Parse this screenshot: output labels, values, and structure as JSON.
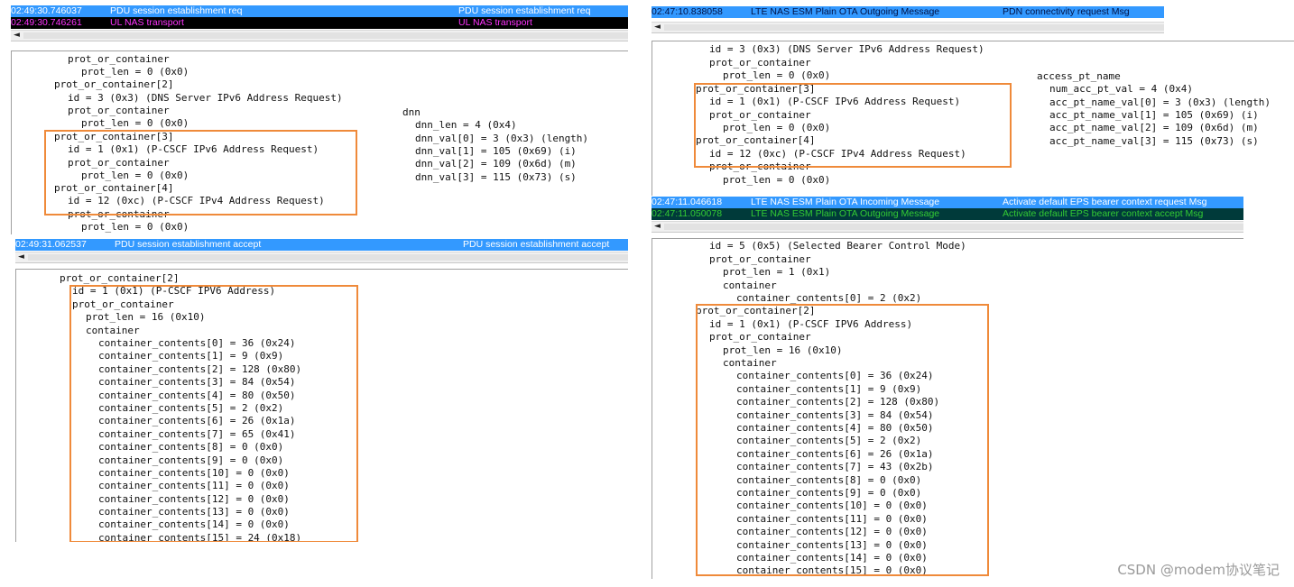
{
  "top_left": {
    "log_rows": [
      {
        "time": "02:49:30.746037",
        "type": "PDU  session  establishment  req",
        "summary": "PDU  session  establishment  req"
      },
      {
        "time": "02:49:30.746261",
        "type": "UL  NAS  transport",
        "summary": "UL  NAS  transport"
      }
    ],
    "scroll_arrow": "◄",
    "tree_lines": [
      "prot_or_container",
      "prot_len = 0 (0x0)",
      "prot_or_container[2]",
      "id = 3 (0x3) (DNS Server IPv6 Address Request)",
      "prot_or_container",
      "prot_len = 0 (0x0)",
      "prot_or_container[3]",
      "id = 1 (0x1) (P-CSCF IPv6 Address Request)",
      "prot_or_container",
      "prot_len = 0 (0x0)",
      "prot_or_container[4]",
      "id = 12 (0xc) (P-CSCF IPv4 Address Request)",
      "prot_or_container",
      "prot_len = 0 (0x0)"
    ],
    "dnn_lines": [
      "dnn",
      "dnn_len = 4 (0x4)",
      "dnn_val[0] = 3 (0x3) (length)",
      "dnn_val[1] = 105 (0x69) (i)",
      "dnn_val[2] = 109 (0x6d) (m)",
      "dnn_val[3] = 115 (0x73) (s)"
    ]
  },
  "bottom_left": {
    "log_rows": [
      {
        "time": "02:49:31.062537",
        "type": "PDU  session  establishment  accept",
        "summary": "PDU  session  establishment  accept"
      }
    ],
    "scroll_arrow": "◄",
    "tree_lines": [
      "prot_or_container[2]",
      "id = 1 (0x1) (P-CSCF IPV6 Address)",
      "prot_or_container",
      "prot_len = 16 (0x10)",
      "container",
      "container_contents[0] = 36 (0x24)",
      "container_contents[1] = 9 (0x9)",
      "container_contents[2] = 128 (0x80)",
      "container_contents[3] = 84 (0x54)",
      "container_contents[4] = 80 (0x50)",
      "container_contents[5] = 2 (0x2)",
      "container_contents[6] = 26 (0x1a)",
      "container_contents[7] = 65 (0x41)",
      "container_contents[8] = 0 (0x0)",
      "container_contents[9] = 0 (0x0)",
      "container_contents[10] = 0 (0x0)",
      "container_contents[11] = 0 (0x0)",
      "container_contents[12] = 0 (0x0)",
      "container_contents[13] = 0 (0x0)",
      "container_contents[14] = 0 (0x0)",
      "container_contents[15] = 24 (0x18)"
    ]
  },
  "top_right": {
    "log_rows": [
      {
        "time": "02:47:10.838058",
        "type": "LTE  NAS  ESM  Plain  OTA  Outgoing  Message",
        "summary": "PDN  connectivity  request  Msg"
      }
    ],
    "scroll_arrow": "◄",
    "tree_lines": [
      "id = 3 (0x3) (DNS Server IPv6 Address Request)",
      "prot_or_container",
      "prot_len = 0 (0x0)",
      "prot_or_container[3]",
      "id = 1 (0x1) (P-CSCF IPv6 Address Request)",
      "prot_or_container",
      "prot_len = 0 (0x0)",
      "prot_or_container[4]",
      "id = 12 (0xc) (P-CSCF IPv4 Address Request)",
      "prot_or_container",
      "prot_len = 0 (0x0)"
    ],
    "apn_lines": [
      "access_pt_name",
      "num_acc_pt_val = 4 (0x4)",
      "acc_pt_name_val[0] = 3 (0x3) (length)",
      "acc_pt_name_val[1] = 105 (0x69) (i)",
      "acc_pt_name_val[2] = 109 (0x6d) (m)",
      "acc_pt_name_val[3] = 115 (0x73) (s)"
    ]
  },
  "bottom_right": {
    "log_rows": [
      {
        "time": "02:47:11.046618",
        "type": "LTE  NAS  ESM  Plain  OTA  Incoming  Message",
        "summary": "Activate  default  EPS  bearer  context  request  Msg"
      },
      {
        "time": "02:47:11.050078",
        "type": "LTE  NAS  ESM  Plain  OTA  Outgoing  Message",
        "summary": "Activate  default  EPS  bearer  context  accept  Msg"
      }
    ],
    "scroll_arrow": "◄",
    "tree_lines": [
      "id = 5 (0x5) (Selected Bearer Control Mode)",
      "prot_or_container",
      "prot_len = 1 (0x1)",
      "container",
      "container_contents[0] = 2 (0x2)",
      "prot_or_container[2]",
      "id = 1 (0x1) (P-CSCF IPV6 Address)",
      "prot_or_container",
      "prot_len = 16 (0x10)",
      "container",
      "container_contents[0] = 36 (0x24)",
      "container_contents[1] = 9 (0x9)",
      "container_contents[2] = 128 (0x80)",
      "container_contents[3] = 84 (0x54)",
      "container_contents[4] = 80 (0x50)",
      "container_contents[5] = 2 (0x2)",
      "container_contents[6] = 26 (0x1a)",
      "container_contents[7] = 43 (0x2b)",
      "container_contents[8] = 0 (0x0)",
      "container_contents[9] = 0 (0x0)",
      "container_contents[10] = 0 (0x0)",
      "container_contents[11] = 0 (0x0)",
      "container_contents[12] = 0 (0x0)",
      "container_contents[13] = 0 (0x0)",
      "container_contents[14] = 0 (0x0)",
      "container_contents[15] = 0 (0x0)"
    ]
  },
  "watermark": "CSDN @modem协议笔记",
  "colors": {
    "selected_row": "#3399ff",
    "black_row": "#000000",
    "magenta_text": "#ff33ff",
    "dark_green_row": "#003a3a",
    "green_text": "#33cc33",
    "highlight_box": "#ef8a3a"
  }
}
